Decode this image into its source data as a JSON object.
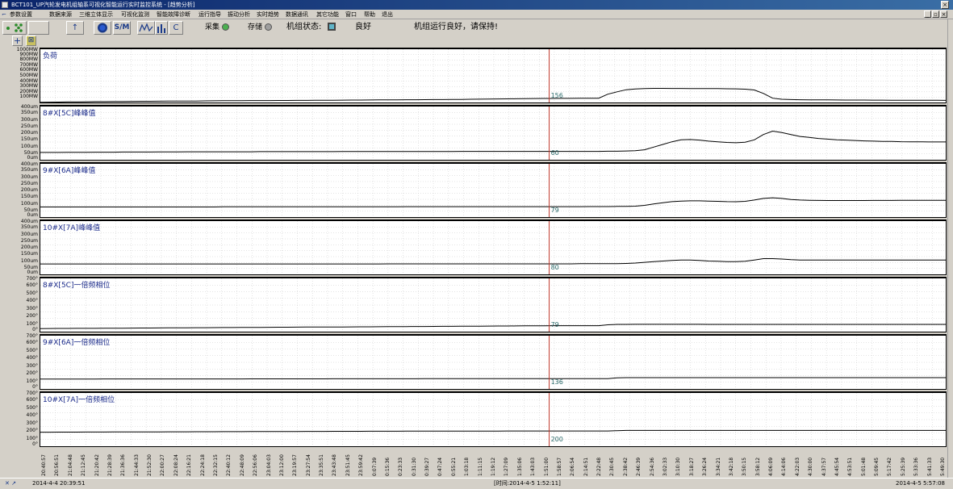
{
  "window": {
    "title": "BCT101_UP汽轮发电机组轴系可视化智能运行实时监控系统 - [趋势分析]"
  },
  "menu": [
    "参数设置",
    "数据来源",
    "三维立体显示",
    "可视化监测",
    "智能故障诊断",
    "运行指导",
    "振动分析",
    "实时趋势",
    "数据通讯",
    "其它功能",
    "窗口",
    "帮助",
    "退出"
  ],
  "toolbar": {
    "collect_label": "采集",
    "store_label": "存储",
    "unit_status_label": "机组状态:",
    "unit_status_value": "良好",
    "message": "机组运行良好，请保持!"
  },
  "colors": {
    "cursor_line": "#c0392b",
    "trace": "#000000",
    "grid": "#c8c8c8",
    "collect_led": "#4caf50",
    "store_led": "#9e9e9e",
    "status_square": "#5fb4c8"
  },
  "chart_data": [
    {
      "type": "line",
      "title": "负荷",
      "yticks": [
        "100MW",
        "200MW",
        "300MW",
        "400MW",
        "500MW",
        "600MW",
        "700MW",
        "800MW",
        "900MW",
        "1000MW"
      ],
      "ylim": [
        0,
        1000
      ],
      "cursor_value": "156",
      "values": [
        5,
        6,
        8,
        10,
        12,
        14,
        16,
        17,
        19,
        20,
        21,
        22,
        23,
        24,
        25,
        26,
        27,
        28,
        30,
        32,
        33,
        34,
        35,
        36,
        36,
        37,
        38,
        38,
        39,
        40,
        41,
        42,
        43,
        44,
        45,
        46,
        47,
        48,
        49,
        50,
        51,
        52,
        53,
        54,
        55,
        56,
        58,
        60,
        62,
        64,
        66,
        68,
        70,
        72,
        74,
        75,
        76,
        77,
        78,
        79,
        80,
        80,
        156,
        200,
        240,
        255,
        262,
        265,
        265,
        264,
        263,
        262,
        262,
        261,
        260,
        258,
        256,
        250,
        235,
        170,
        80,
        60,
        55,
        52,
        50,
        49,
        48,
        47,
        46,
        45,
        45,
        44,
        44,
        43,
        43,
        42,
        42,
        41,
        41,
        40
      ]
    },
    {
      "type": "line",
      "title": "8#X[5C]峰峰值",
      "yticks": [
        "0um",
        "50um",
        "100um",
        "150um",
        "200um",
        "250um",
        "300um",
        "350um",
        "400um"
      ],
      "ylim": [
        0,
        400
      ],
      "cursor_value": "60",
      "values": [
        55,
        55,
        55,
        56,
        56,
        56,
        57,
        57,
        57,
        58,
        58,
        58,
        58,
        59,
        59,
        59,
        60,
        60,
        60,
        60,
        60,
        60,
        60,
        60,
        61,
        61,
        61,
        61,
        61,
        61,
        61,
        61,
        61,
        62,
        62,
        62,
        62,
        62,
        62,
        62,
        62,
        62,
        62,
        62,
        62,
        62,
        63,
        63,
        63,
        63,
        63,
        63,
        63,
        63,
        63,
        63,
        63,
        63,
        63,
        63,
        63,
        63,
        64,
        64,
        66,
        68,
        75,
        95,
        115,
        135,
        150,
        152,
        148,
        140,
        135,
        130,
        128,
        132,
        150,
        190,
        215,
        205,
        190,
        175,
        168,
        160,
        155,
        150,
        148,
        145,
        142,
        140,
        138,
        138,
        136,
        135,
        135,
        134,
        134,
        134
      ]
    },
    {
      "type": "line",
      "title": "9#X[6A]峰峰值",
      "yticks": [
        "0um",
        "50um",
        "100um",
        "150um",
        "200um",
        "250um",
        "300um",
        "350um",
        "400um"
      ],
      "ylim": [
        0,
        400
      ],
      "cursor_value": "79",
      "values": [
        76,
        76,
        76,
        76,
        76,
        76,
        76,
        76,
        76,
        76,
        76,
        76,
        76,
        76,
        76,
        76,
        76,
        76,
        76,
        76,
        77,
        77,
        77,
        77,
        77,
        77,
        77,
        77,
        77,
        77,
        77,
        77,
        77,
        77,
        77,
        77,
        77,
        77,
        77,
        77,
        78,
        78,
        78,
        78,
        78,
        78,
        78,
        78,
        78,
        78,
        78,
        78,
        78,
        78,
        78,
        78,
        78,
        78,
        78,
        78,
        79,
        79,
        79,
        80,
        80,
        82,
        88,
        98,
        108,
        116,
        120,
        122,
        122,
        120,
        118,
        116,
        115,
        118,
        128,
        140,
        145,
        140,
        132,
        128,
        126,
        125,
        124,
        124,
        124,
        124,
        124,
        125,
        125,
        125,
        126,
        126,
        126,
        126,
        126,
        126
      ]
    },
    {
      "type": "line",
      "title": "10#X[7A]峰峰值",
      "yticks": [
        "0um",
        "50um",
        "100um",
        "150um",
        "200um",
        "250um",
        "300um",
        "350um",
        "400um"
      ],
      "ylim": [
        0,
        400
      ],
      "cursor_value": "80",
      "values": [
        78,
        78,
        78,
        78,
        78,
        78,
        78,
        78,
        78,
        78,
        78,
        78,
        78,
        78,
        78,
        78,
        78,
        78,
        78,
        78,
        78,
        78,
        78,
        78,
        78,
        78,
        78,
        78,
        78,
        78,
        78,
        78,
        78,
        78,
        78,
        78,
        78,
        78,
        79,
        79,
        79,
        79,
        79,
        79,
        79,
        79,
        79,
        79,
        79,
        79,
        79,
        79,
        79,
        79,
        79,
        79,
        79,
        79,
        79,
        80,
        80,
        80,
        80,
        80,
        82,
        85,
        90,
        95,
        100,
        105,
        108,
        108,
        105,
        100,
        98,
        96,
        96,
        98,
        108,
        118,
        118,
        115,
        110,
        108,
        108,
        107,
        107,
        107,
        108,
        108,
        108,
        108,
        108,
        108,
        108,
        108,
        108,
        108,
        108,
        108
      ]
    },
    {
      "type": "line",
      "title": "8#X[5C]一倍频相位",
      "yticks": [
        "0°",
        "100°",
        "200°",
        "300°",
        "400°",
        "500°",
        "600°",
        "700°"
      ],
      "ylim": [
        0,
        700
      ],
      "cursor_value": "79",
      "values": [
        40,
        41,
        42,
        42,
        43,
        44,
        44,
        45,
        46,
        46,
        47,
        48,
        48,
        49,
        50,
        50,
        51,
        52,
        52,
        53,
        54,
        54,
        55,
        56,
        56,
        57,
        58,
        58,
        59,
        60,
        60,
        61,
        62,
        62,
        63,
        64,
        64,
        65,
        66,
        66,
        67,
        68,
        68,
        69,
        70,
        70,
        71,
        72,
        72,
        73,
        74,
        74,
        75,
        76,
        76,
        77,
        78,
        78,
        79,
        79,
        79,
        79,
        90,
        95,
        95,
        96,
        96,
        96,
        96,
        96,
        96,
        96,
        96,
        95,
        95,
        95,
        95,
        95,
        95,
        95,
        95,
        95,
        95,
        95,
        95,
        95,
        95,
        95,
        95,
        95,
        95,
        95,
        95,
        95,
        95,
        95,
        95,
        95,
        95,
        95
      ]
    },
    {
      "type": "line",
      "title": "9#X[6A]一倍频相位",
      "yticks": [
        "0°",
        "100°",
        "200°",
        "300°",
        "400°",
        "500°",
        "600°",
        "700°"
      ],
      "ylim": [
        0,
        700
      ],
      "cursor_value": "136",
      "values": [
        130,
        130,
        130,
        130,
        130,
        130,
        130,
        131,
        131,
        131,
        131,
        131,
        131,
        131,
        131,
        132,
        132,
        132,
        132,
        132,
        132,
        132,
        132,
        133,
        133,
        133,
        133,
        133,
        133,
        133,
        133,
        133,
        134,
        134,
        134,
        134,
        134,
        134,
        134,
        134,
        134,
        134,
        135,
        135,
        135,
        135,
        135,
        135,
        135,
        135,
        135,
        135,
        135,
        135,
        136,
        136,
        136,
        136,
        136,
        136,
        136,
        136,
        136,
        145,
        148,
        148,
        148,
        148,
        148,
        148,
        148,
        148,
        148,
        148,
        148,
        148,
        148,
        148,
        148,
        148,
        148,
        148,
        148,
        148,
        148,
        148,
        148,
        148,
        148,
        148,
        148,
        148,
        148,
        148,
        148,
        148,
        148,
        148,
        148,
        148
      ]
    },
    {
      "type": "line",
      "title": "10#X[7A]一倍频相位",
      "yticks": [
        "0°",
        "100°",
        "200°",
        "300°",
        "400°",
        "500°",
        "600°",
        "700°"
      ],
      "ylim": [
        0,
        700
      ],
      "cursor_value": "200",
      "values": [
        185,
        185,
        186,
        186,
        186,
        187,
        187,
        187,
        188,
        188,
        188,
        189,
        189,
        189,
        190,
        190,
        190,
        191,
        191,
        191,
        192,
        192,
        192,
        193,
        193,
        193,
        194,
        194,
        194,
        195,
        195,
        195,
        196,
        196,
        196,
        196,
        197,
        197,
        197,
        197,
        198,
        198,
        198,
        198,
        198,
        199,
        199,
        199,
        199,
        199,
        199,
        200,
        200,
        200,
        200,
        200,
        200,
        200,
        200,
        200,
        200,
        200,
        200,
        205,
        208,
        208,
        208,
        208,
        208,
        208,
        208,
        208,
        208,
        208,
        208,
        208,
        208,
        208,
        208,
        208,
        208,
        208,
        208,
        208,
        208,
        208,
        208,
        208,
        208,
        208,
        208,
        208,
        208,
        208,
        208,
        208,
        208,
        208,
        208,
        208
      ]
    }
  ],
  "xaxis_labels": [
    "20:40:57",
    "20:56:51",
    "21:04:48",
    "21:12:45",
    "21:20:42",
    "21:28:39",
    "21:36:36",
    "21:44:33",
    "21:52:30",
    "22:00:27",
    "22:08:24",
    "22:16:21",
    "22:24:18",
    "22:32:15",
    "22:40:12",
    "22:48:09",
    "22:56:06",
    "23:04:03",
    "23:12:00",
    "23:19:57",
    "23:27:54",
    "23:35:51",
    "23:43:48",
    "23:51:45",
    "23:59:42",
    "0:07:39",
    "0:15:36",
    "0:23:33",
    "0:31:30",
    "0:39:27",
    "0:47:24",
    "0:55:21",
    "1:03:18",
    "1:11:15",
    "1:19:12",
    "1:27:09",
    "1:35:06",
    "1:43:03",
    "1:51:00",
    "1:58:57",
    "2:06:54",
    "2:14:51",
    "2:22:48",
    "2:30:45",
    "2:38:42",
    "2:46:39",
    "2:54:36",
    "3:02:33",
    "3:10:30",
    "3:18:27",
    "3:26:24",
    "3:34:21",
    "3:42:18",
    "3:50:15",
    "3:58:12",
    "4:06:09",
    "4:14:06",
    "4:22:03",
    "4:30:00",
    "4:37:57",
    "4:45:54",
    "4:53:51",
    "5:01:48",
    "5:09:45",
    "5:17:42",
    "5:25:39",
    "5:33:36",
    "5:41:33",
    "5:49:30"
  ],
  "statusbar": {
    "left_time": "2014-4-4  20:39:51",
    "cursor_time": "[时间:2014-4-5  1:52:11]",
    "right_time": "2014-4-5  5:57:08"
  }
}
